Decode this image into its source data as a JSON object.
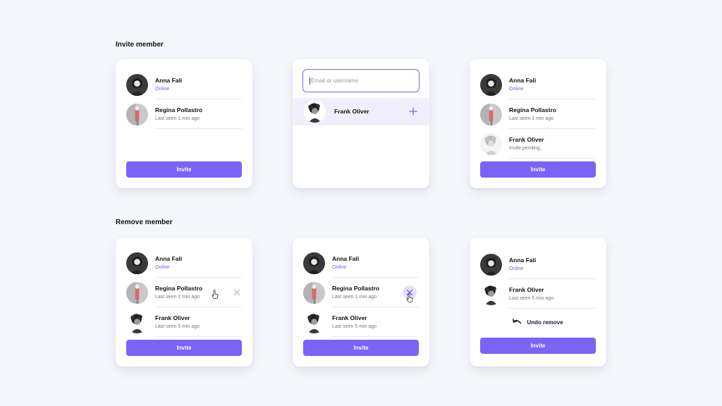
{
  "sections": {
    "invite_title": "Invite member",
    "remove_title": "Remove member"
  },
  "members": {
    "anna": {
      "name": "Anna Fali",
      "status": "Online"
    },
    "regina": {
      "name": "Regina Pollastro",
      "status": "Last seen 1 min ago"
    },
    "frank_pending": {
      "name": "Frank Oliver",
      "status": "Invite pending.."
    },
    "frank": {
      "name": "Frank Oliver",
      "status": "Last seen 5 min ago"
    }
  },
  "search": {
    "placeholder": "Email or username",
    "suggestion_name": "Frank Oliver"
  },
  "buttons": {
    "invite": "Invite",
    "undo_remove": "Undo remove"
  },
  "colors": {
    "accent": "#7b63f6",
    "online": "#6f5cf5",
    "background": "#f5f7fc"
  }
}
